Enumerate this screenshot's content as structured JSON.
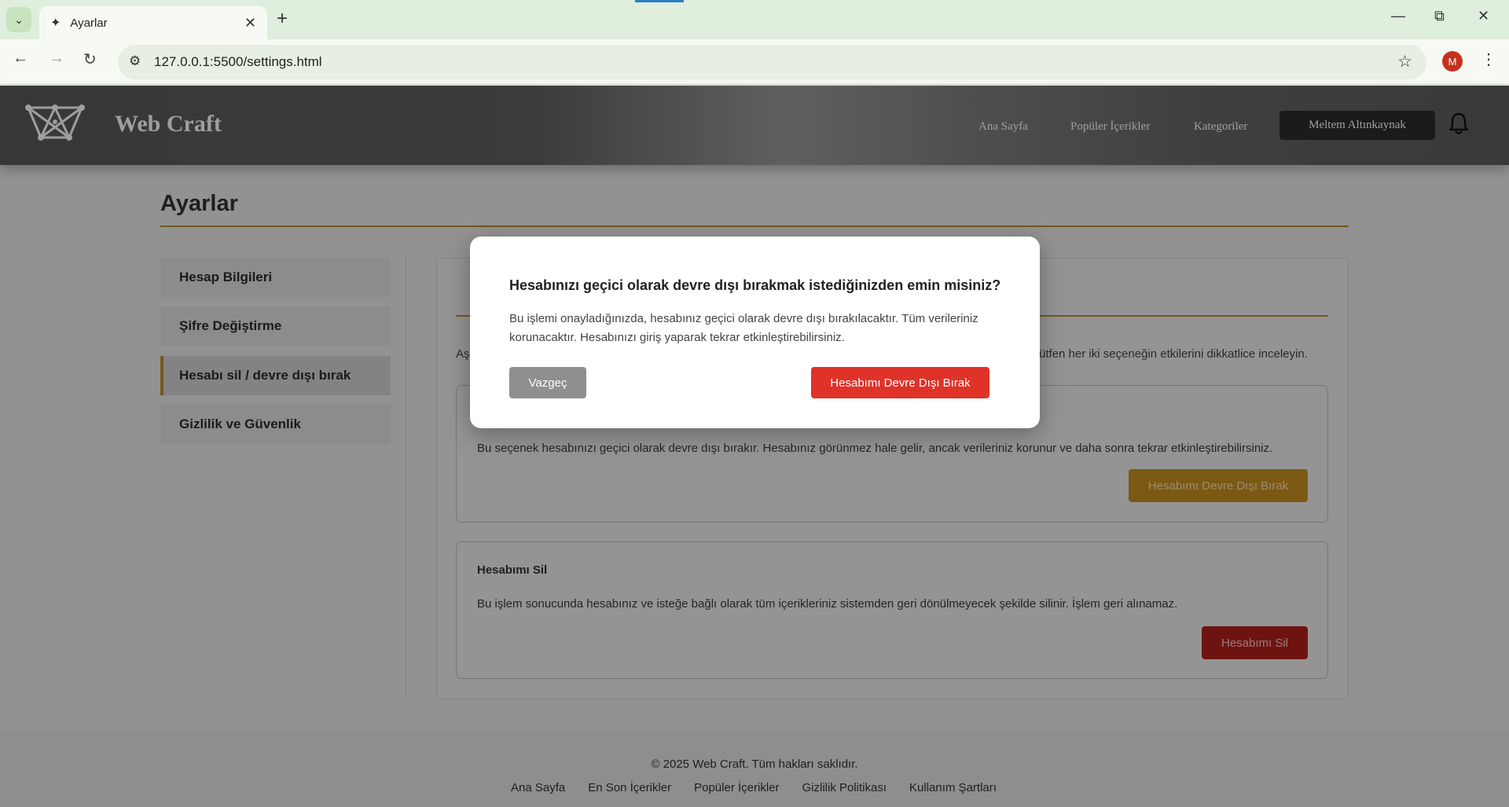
{
  "browser": {
    "tab_title": "Ayarlar",
    "url": "127.0.0.1:5500/settings.html",
    "profile_initial": "M",
    "icons": {
      "tab_dropdown": "chevron-down-icon",
      "favicon": "webcraft-icon",
      "tab_close": "close-icon",
      "new_tab": "plus-icon",
      "back": "back-arrow-icon",
      "forward": "forward-arrow-icon",
      "reload": "reload-icon",
      "site_info": "tune-icon",
      "bookmark": "star-icon",
      "menu": "kebab-icon",
      "minimize": "minimize-icon",
      "restore": "restore-icon",
      "close": "close-window-icon"
    }
  },
  "header": {
    "brand": "Web Craft",
    "nav": [
      "Ana Sayfa",
      "Popüler İçerikler",
      "Kategoriler"
    ],
    "user_name": "Meltem Altınkaynak",
    "icons": {
      "logo": "network-logo-icon",
      "notifications": "bell-icon"
    }
  },
  "page": {
    "title": "Ayarlar",
    "sidebar": [
      {
        "label": "Hesap Bilgileri",
        "active": false
      },
      {
        "label": "Şifre Değiştirme",
        "active": false
      },
      {
        "label": "Hesabı sil / devre dışı bırak",
        "active": true
      },
      {
        "label": "Gizlilik ve Güvenlik",
        "active": false
      }
    ],
    "intro_left": "Aş",
    "intro_right": "ütfen her iki seçeneğin etkilerini dikkatlice inceleyin.",
    "deactivate_card": {
      "description": "Bu seçenek hesabınızı geçici olarak devre dışı bırakır. Hesabınız görünmez hale gelir, ancak verileriniz korunur ve daha sonra tekrar etkinleştirebilirsiniz.",
      "button": "Hesabımı Devre Dışı Bırak"
    },
    "delete_card": {
      "title": "Hesabımı Sil",
      "description": "Bu işlem sonucunda hesabınız ve isteğe bağlı olarak tüm içerikleriniz sistemden geri dönülmeyecek şekilde silinir. İşlem geri alınamaz.",
      "button": "Hesabımı Sil"
    }
  },
  "footer": {
    "copyright": "© 2025 Web Craft. Tüm hakları saklıdır.",
    "links": [
      "Ana Sayfa",
      "En Son İçerikler",
      "Popüler İçerikler",
      "Gizlilik Politikası",
      "Kullanım Şartları"
    ]
  },
  "modal": {
    "title": "Hesabınızı geçici olarak devre dışı bırakmak istediğinizden emin misiniz?",
    "body": "Bu işlemi onayladığınızda, hesabınız geçici olarak devre dışı bırakılacaktır. Tüm verileriniz korunacaktır. Hesabınızı giriş yaparak tekrar etkinleştirebilirsiniz.",
    "cancel": "Vazgeç",
    "confirm": "Hesabımı Devre Dışı Bırak"
  },
  "colors": {
    "accent": "#b8922e",
    "danger": "#e03228",
    "amber_button": "#c8901e"
  }
}
